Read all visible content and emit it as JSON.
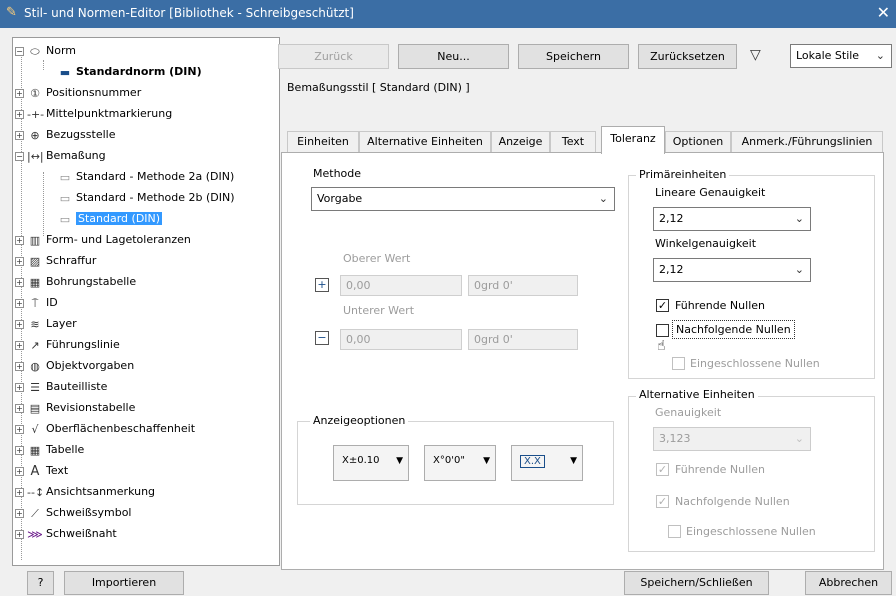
{
  "window": {
    "title": "Stil- und Normen-Editor [Bibliothek - Schreibgeschützt]",
    "close": "✕"
  },
  "tree": {
    "items": [
      {
        "label": "Norm",
        "icon": "norm-icon"
      },
      {
        "label": "Standardnorm (DIN)",
        "icon": "standard-icon"
      },
      {
        "label": "Positionsnummer",
        "icon": "balloon-icon"
      },
      {
        "label": "Mittelpunktmarkierung",
        "icon": "center-mark-icon"
      },
      {
        "label": "Bezugsstelle",
        "icon": "datum-icon"
      },
      {
        "label": "Bemaßung",
        "icon": "dimension-icon"
      },
      {
        "label": "Standard - Methode 2a (DIN)",
        "icon": "style-icon"
      },
      {
        "label": "Standard - Methode 2b (DIN)",
        "icon": "style-icon"
      },
      {
        "label": "Standard (DIN)",
        "icon": "style-icon"
      },
      {
        "label": "Form- und Lagetoleranzen",
        "icon": "gdt-icon"
      },
      {
        "label": "Schraffur",
        "icon": "hatch-icon"
      },
      {
        "label": "Bohrungstabelle",
        "icon": "hole-table-icon"
      },
      {
        "label": "ID",
        "icon": "id-icon"
      },
      {
        "label": "Layer",
        "icon": "layer-icon"
      },
      {
        "label": "Führungslinie",
        "icon": "leader-icon"
      },
      {
        "label": "Objektvorgaben",
        "icon": "object-defaults-icon"
      },
      {
        "label": "Bauteilliste",
        "icon": "parts-list-icon"
      },
      {
        "label": "Revisionstabelle",
        "icon": "revision-table-icon"
      },
      {
        "label": "Oberflächenbeschaffenheit",
        "icon": "surface-icon"
      },
      {
        "label": "Tabelle",
        "icon": "table-icon"
      },
      {
        "label": "Text",
        "icon": "text-icon"
      },
      {
        "label": "Ansichtsanmerkung",
        "icon": "view-annotation-icon"
      },
      {
        "label": "Schweißsymbol",
        "icon": "weld-symbol-icon"
      },
      {
        "label": "Schweißnaht",
        "icon": "weld-bead-icon"
      }
    ]
  },
  "toolbar": {
    "back": "Zurück",
    "new": "Neu...",
    "save": "Speichern",
    "reset": "Zurücksetzen",
    "filter_value": "Lokale Stile"
  },
  "style_header": "Bemaßungsstil [ Standard (DIN) ]",
  "tabs": [
    "Einheiten",
    "Alternative Einheiten",
    "Anzeige",
    "Text",
    "Toleranz",
    "Optionen",
    "Anmerk./Führungslinien"
  ],
  "active_tab": "Toleranz",
  "method": {
    "label": "Methode",
    "value": "Vorgabe"
  },
  "upper": {
    "label": "Oberer Wert",
    "value": "0,00",
    "angle": "0grd 0'",
    "sign": "+"
  },
  "lower": {
    "label": "Unterer Wert",
    "value": "0,00",
    "angle": "0grd 0'",
    "sign": "−"
  },
  "display_options": {
    "title": "Anzeigeoptionen",
    "opt1_symbol": "X±0.10",
    "opt2_symbol": "X°0'0\"",
    "opt3_symbol": "X.X"
  },
  "primary": {
    "title": "Primäreinheiten",
    "linear_label": "Lineare Genauigkeit",
    "linear_value": "2,12",
    "angular_label": "Winkelgenauigkeit",
    "angular_value": "2,12",
    "leading_zeros": "Führende Nullen",
    "trailing_zeros": "Nachfolgende Nullen",
    "enclosed_zeros": "Eingeschlossene Nullen"
  },
  "alternate": {
    "title": "Alternative Einheiten",
    "precision_label": "Genauigkeit",
    "precision_value": "3,123",
    "leading_zeros": "Führende Nullen",
    "trailing_zeros": "Nachfolgende Nullen",
    "enclosed_zeros": "Eingeschlossene Nullen"
  },
  "footer": {
    "help": "?",
    "import": "Importieren",
    "save_close": "Speichern/Schließen",
    "cancel": "Abbrechen"
  }
}
